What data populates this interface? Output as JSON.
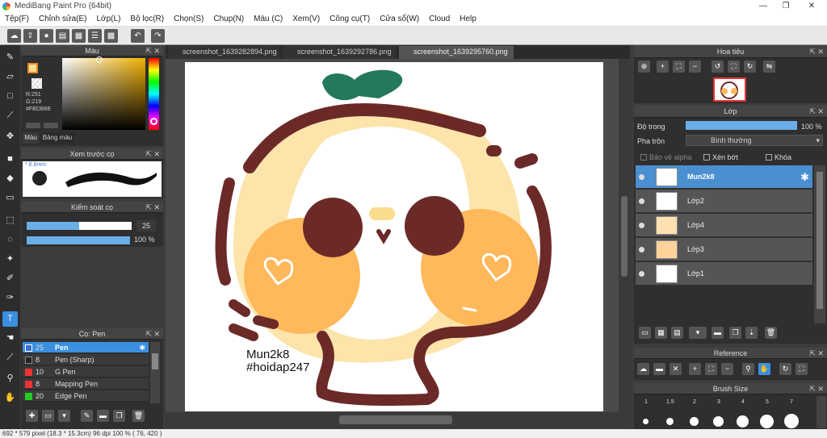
{
  "app": {
    "title": "MediBang Paint Pro (64bit)"
  },
  "menu": [
    "Tệp(F)",
    "Chỉnh sửa(E)",
    "Lớp(L)",
    "Bộ lọc(R)",
    "Chọn(S)",
    "Chụp(N)",
    "Màu (C)",
    "Xem(V)",
    "Công cụ(T)",
    "Cửa sổ(W)",
    "Cloud",
    "Help"
  ],
  "color_panel": {
    "title": "Màu",
    "r": "R:251",
    "g": "G:219",
    "hex": "#FBDB8E",
    "tab1": "Màu",
    "tab2": "Bảng màu",
    "primary": "#FBDB8E"
  },
  "brush_preview": {
    "title": "Xem trước cọ",
    "size": "6.6mm"
  },
  "brush_control": {
    "title": "Kiểm soát cọ",
    "size": "25",
    "opacity": "100 %"
  },
  "brush_list": {
    "title": "Cọ: Pen",
    "items": [
      {
        "num": "25",
        "label": "Pen",
        "color": "#3a6fd8"
      },
      {
        "num": "8",
        "label": "Pen (Sharp)",
        "color": "#222"
      },
      {
        "num": "10",
        "label": "G Pen",
        "color": "#e33"
      },
      {
        "num": "8",
        "label": "Mapping Pen",
        "color": "#e33"
      },
      {
        "num": "20",
        "label": "Edge Pen",
        "color": "#2c2"
      }
    ]
  },
  "tabs": [
    "screenshot_1639282894.png",
    "screenshot_1639292786.png",
    "screenshot_1639295760.png"
  ],
  "canvas_text": [
    "Mun2k8",
    "#hoidap247"
  ],
  "navigator": {
    "title": "Hoa tiêu"
  },
  "layer_panel": {
    "title": "Lớp",
    "opacity_label": "Độ trong",
    "opacity_value": "100 %",
    "blend_label": "Pha trộn",
    "blend_value": "Bình thường",
    "protect_alpha": "Bảo vệ alpha",
    "clip": "Xén bớt",
    "lock": "Khóa",
    "layers": [
      "Mun2k8",
      "Lớp2",
      "Lớp4",
      "Lớp3",
      "Lớp1"
    ]
  },
  "reference": {
    "title": "Reference"
  },
  "brush_size": {
    "title": "Brush Size",
    "values": [
      "1",
      "1.5",
      "2",
      "3",
      "4",
      "5",
      "7"
    ]
  },
  "status": "692 * 579 pixel  (18.3 * 15.3cm)  96 dpi  100 %  ( 76, 420 )"
}
